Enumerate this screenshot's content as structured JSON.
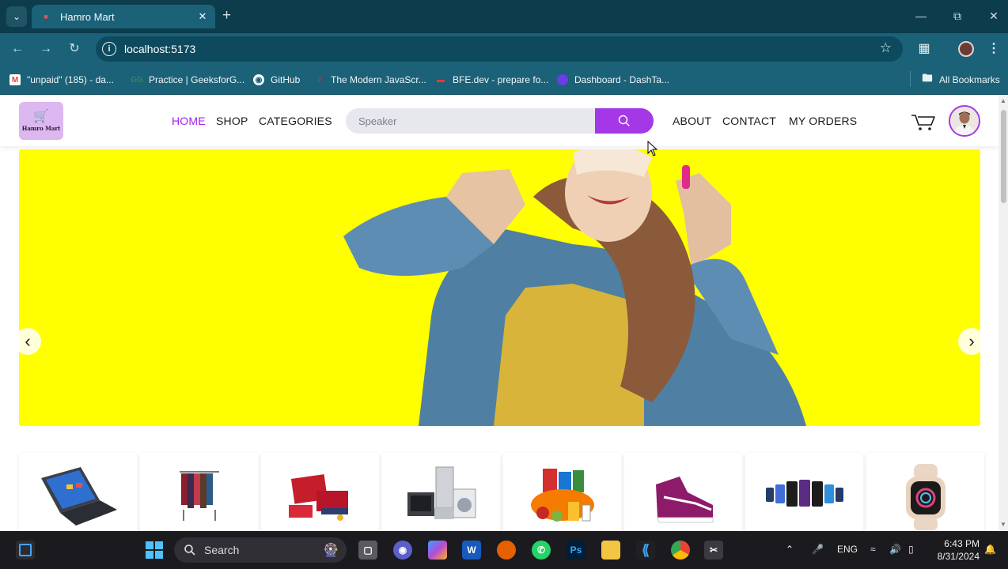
{
  "browser": {
    "tab_title": "Hamro Mart",
    "tab_close": "✕",
    "new_tab": "+",
    "url": "localhost:5173",
    "bookmarks": [
      {
        "label": "\"unpaid\" (185) - da...",
        "icon": "gmail-icon"
      },
      {
        "label": "Practice | GeeksforG...",
        "icon": "geeksforgeeks-icon"
      },
      {
        "label": "GitHub",
        "icon": "github-icon"
      },
      {
        "label": "The Modern JavaScr...",
        "icon": "javascript-info-icon"
      },
      {
        "label": "BFE.dev - prepare fo...",
        "icon": "bfe-icon"
      },
      {
        "label": "Dashboard - DashTa...",
        "icon": "dashboard-icon"
      }
    ],
    "all_bookmarks": "All Bookmarks"
  },
  "navbar": {
    "logo_text": "Hamro Mart",
    "links_left": [
      "HOME",
      "SHOP",
      "CATEGORIES"
    ],
    "links_right": [
      "ABOUT",
      "CONTACT",
      "MY ORDERS"
    ],
    "active_link": "HOME",
    "search_placeholder": "Speaker",
    "accent_color": "#a437e6"
  },
  "hero": {
    "background": "#ffff00",
    "prev_arrow": "‹",
    "next_arrow": "›"
  },
  "categories": [
    {
      "icon": "laptop-icon"
    },
    {
      "icon": "clothing-rack-icon"
    },
    {
      "icon": "gift-set-icon"
    },
    {
      "icon": "appliances-icon"
    },
    {
      "icon": "groceries-icon"
    },
    {
      "icon": "sneaker-icon"
    },
    {
      "icon": "smartphones-icon"
    },
    {
      "icon": "smartwatch-icon"
    }
  ],
  "taskbar": {
    "search_label": "Search",
    "language": "ENG",
    "time": "6:43 PM",
    "date": "8/31/2024"
  }
}
